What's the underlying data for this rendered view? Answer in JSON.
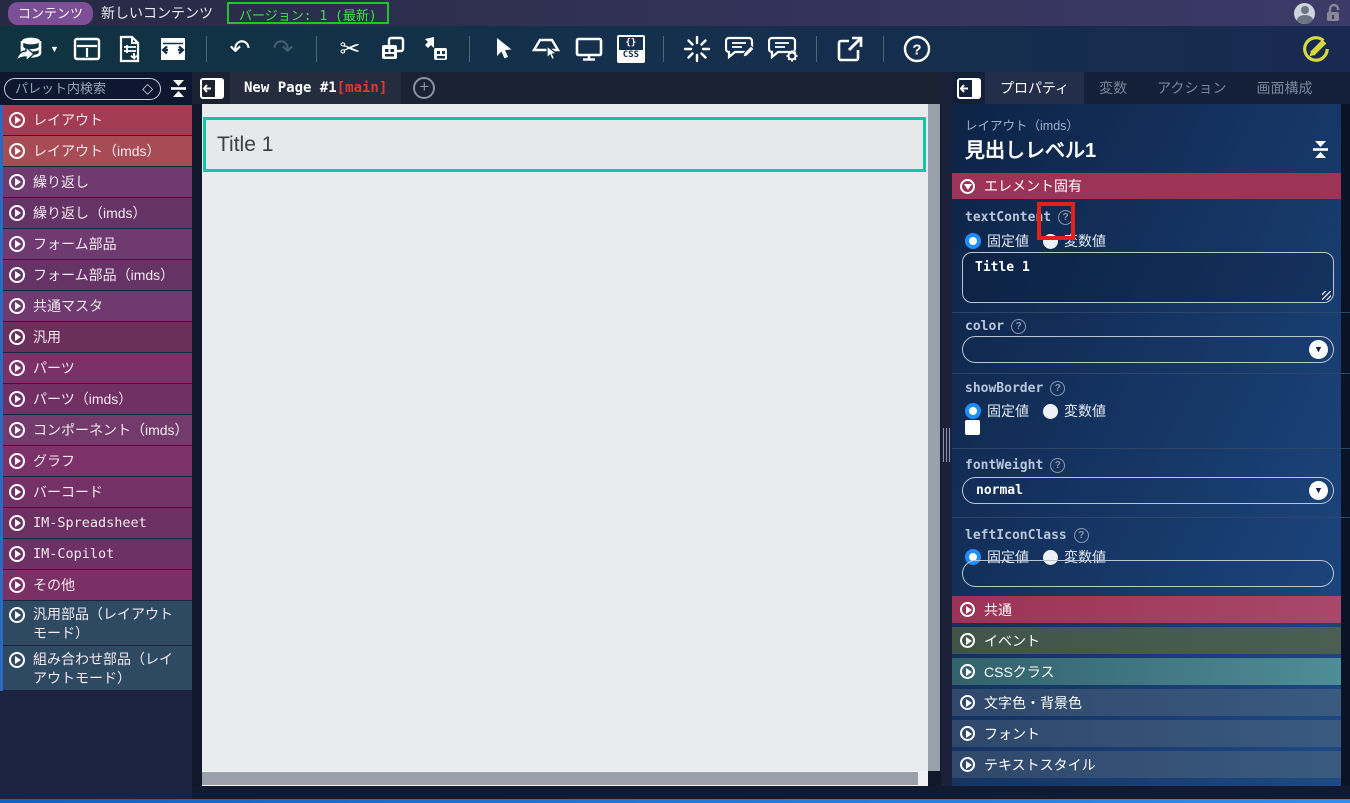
{
  "colors": {
    "accent_teal": "#14c4aa",
    "version_green": "#1ec42a",
    "main_red": "#e8352c",
    "annotation_red": "#e52017",
    "radio_blue": "#1e8fff",
    "pencil_yellow": "#d6d93f"
  },
  "topbar": {
    "badge": "コンテンツ",
    "title": "新しいコンテンツ",
    "version": "バージョン: 1 (最新)"
  },
  "toolbar": {
    "icons": [
      "database-import",
      "layout-template",
      "export-document",
      "window-swap",
      "undo",
      "redo",
      "cut",
      "copy",
      "paste",
      "cursor",
      "select-element",
      "preview-monitor",
      "css",
      "spinner",
      "comment-edit",
      "comment-settings",
      "open-external",
      "help",
      "edit-mode-pencil"
    ],
    "css_icon_top": "{}",
    "css_icon_bottom": "CSS"
  },
  "palette": {
    "search_placeholder": "パレット内検索",
    "items": [
      {
        "label": "レイアウト",
        "color": "#a33b53"
      },
      {
        "label": "レイアウト（imds）",
        "color": "#a74b55"
      },
      {
        "label": "繰り返し",
        "color": "#6e3a70"
      },
      {
        "label": "繰り返し（imds）",
        "color": "#653366"
      },
      {
        "label": "フォーム部品",
        "color": "#6e3a70"
      },
      {
        "label": "フォーム部品（imds）",
        "color": "#653366"
      },
      {
        "label": "共通マスタ",
        "color": "#6e3a70"
      },
      {
        "label": "汎用",
        "color": "#6b2f5c"
      },
      {
        "label": "パーツ",
        "color": "#7b3168"
      },
      {
        "label": "パーツ（imds）",
        "color": "#703064"
      },
      {
        "label": "コンポーネント（imds）",
        "color": "#723b6b"
      },
      {
        "label": "グラフ",
        "color": "#7c3168"
      },
      {
        "label": "バーコード",
        "color": "#733166"
      },
      {
        "label": "IM-Spreadsheet",
        "color": "#6c3162",
        "mono": true
      },
      {
        "label": "IM-Copilot",
        "color": "#6e3165",
        "mono": true
      },
      {
        "label": "その他",
        "color": "#7b3065"
      },
      {
        "label": "汎用部品（レイアウトモード）",
        "color": "#2e4a63",
        "tall": true
      },
      {
        "label": "組み合わせ部品（レイアウトモード）",
        "color": "#2e4a63",
        "tall": true
      }
    ]
  },
  "canvas": {
    "tab_label": "New Page #1",
    "tab_tag": "[main]",
    "title_text": "Title 1"
  },
  "props": {
    "tabs": [
      "プロパティ",
      "変数",
      "アクション",
      "画面構成"
    ],
    "active_tab": "プロパティ",
    "element_type": "レイアウト（imds）",
    "element_name": "見出しレベル1",
    "section_element": "エレメント固有",
    "radio_fixed": "固定値",
    "radio_variable": "変数値",
    "fields": {
      "textContent": {
        "label": "textContent",
        "value": "Title 1"
      },
      "color": {
        "label": "color",
        "value": ""
      },
      "showBorder": {
        "label": "showBorder",
        "checked": false
      },
      "fontWeight": {
        "label": "fontWeight",
        "value": "normal"
      },
      "leftIconClass": {
        "label": "leftIconClass",
        "value": ""
      }
    },
    "collapsed_sections": [
      {
        "label": "共通",
        "color": "#9c3356",
        "color2": "#a8486a"
      },
      {
        "label": "イベント",
        "color": "#41544a",
        "color2": "#4a5f51"
      },
      {
        "label": "CSSクラス",
        "color": "#33616c",
        "color2": "#4f8d96"
      },
      {
        "label": "文字色・背景色",
        "color": "#2f486b",
        "color2": "#3a5a80"
      },
      {
        "label": "フォント",
        "color": "#2f486b",
        "color2": "#3a5a80"
      },
      {
        "label": "テキストスタイル",
        "color": "#2f486b",
        "color2": "#3a5a80"
      }
    ]
  }
}
